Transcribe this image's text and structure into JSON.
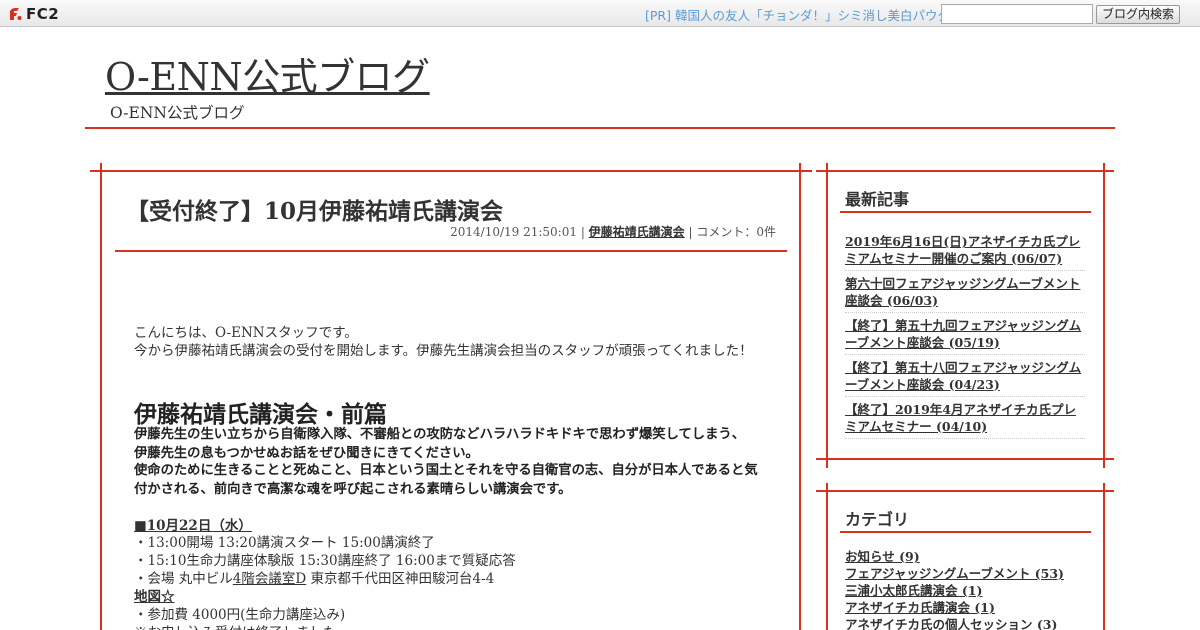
{
  "fc2bar": {
    "logo_text": "FC2",
    "pr_text": "[PR] 韓国人の友人「チョンダ！」シミ消し美白パウダ",
    "search_placeholder": "",
    "search_button": "ブログ内検索"
  },
  "header": {
    "title": "O-ENN公式ブログ",
    "description": "O-ENN公式ブログ"
  },
  "entry": {
    "title": "【受付終了】10月伊藤祐靖氏講演会",
    "date": "2014/10/19 21:50:01",
    "sep1": " | ",
    "category": "伊藤祐靖氏講演会",
    "sep2": " | ",
    "comments": "コメント：0件",
    "greeting": "こんにちは、O-ENNスタッフです。",
    "intro": "今から伊藤祐靖氏講演会の受付を開始します。伊藤先生講演会担当のスタッフが頑張ってくれました！",
    "section_title": "伊藤祐靖氏講演会・前篇",
    "bold_para1": "伊藤先生の生い立ちから自衛隊入隊、不審船との攻防などハラハラドキドキで思わず爆笑してしまう、伊藤先生の息もつかせぬお話をぜひ聞きにきてください。",
    "bold_para2": "使命のために生きることと死ぬこと、日本という国土とそれを守る自衛官の志、自分が日本人であると気付かされる、前向きで高潔な魂を呼び起こされる素晴らしい講演会です。",
    "date_heading": "■10月22日（水）",
    "line1": "・13:00開場 13:20講演スタート 15:00講演終了",
    "line2": "・15:10生命力講座体験版 15:30講座終了 16:00まで質疑応答",
    "venue_prefix": "・会場 丸中ビル",
    "venue_link": "4階会議室D",
    "venue_suffix": " 東京都千代田区神田駿河台4-4",
    "map_link": "地図☆",
    "fee": "・参加費 4000円(生命力講座込み)",
    "closing": "※お申し込み受付は終了しました"
  },
  "sidebar": {
    "recent_title": "最新記事",
    "recent": [
      "2019年6月16日(日)アネザイチカ氏プレミアムセミナー開催のご案内 (06/07)",
      "第六十回フェアジャッジングムーブメント座談会 (06/03)",
      "【終了】第五十九回フェアジャッジングムーブメント座談会 (05/19)",
      "【終了】第五十八回フェアジャッジングムーブメント座談会 (04/23)",
      "【終了】2019年4月アネザイチカ氏プレミアムセミナー (04/10)"
    ],
    "category_title": "カテゴリ",
    "categories": [
      "お知らせ (9)",
      "フェアジャッジングムーブメント (53)",
      "三浦小太郎氏講演会 (1)",
      "アネザイチカ氏講演会 (1)",
      "アネザイチカ氏の個人セッション (3)"
    ]
  },
  "colors": {
    "accent": "#d8321e",
    "pr_link": "#5b9bd5"
  }
}
